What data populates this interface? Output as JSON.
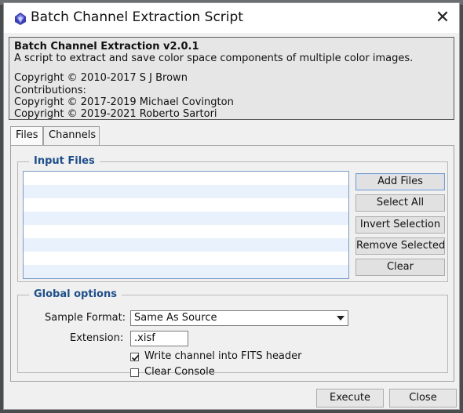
{
  "window": {
    "title": "Batch Channel Extraction Script",
    "close_glyph": "✕",
    "icon": "pixinsight-logo-icon"
  },
  "info": {
    "heading": "Batch Channel Extraction v2.0.1",
    "description": "A script to extract and save color space components of multiple color images.",
    "copyright_1": "Copyright © 2010-2017 S J Brown",
    "contributions": "Contributions:",
    "copyright_2": "Copyright © 2017-2019 Michael Covington",
    "copyright_3": "Copyright © 2019-2021 Roberto Sartori"
  },
  "tabs": [
    {
      "label": "Files",
      "active": true
    },
    {
      "label": "Channels",
      "active": false
    }
  ],
  "input_files": {
    "title": "Input Files",
    "files": [],
    "buttons": {
      "add_files": "Add Files",
      "select_all": "Select All",
      "invert_selection": "Invert Selection",
      "remove_selected": "Remove Selected",
      "clear": "Clear"
    }
  },
  "global_options": {
    "title": "Global options",
    "sample_format_label": "Sample Format:",
    "sample_format_value": "Same As Source",
    "extension_label": "Extension:",
    "extension_value": ".xisf",
    "write_fits_label": "Write channel into FITS header",
    "write_fits_checked": true,
    "clear_console_label": "Clear Console",
    "clear_console_checked": false
  },
  "footer": {
    "execute": "Execute",
    "close": "Close"
  },
  "colors": {
    "group_title": "#1f4f8a",
    "list_alt_row": "#e9f2fc",
    "list_border": "#7a9cc8"
  }
}
